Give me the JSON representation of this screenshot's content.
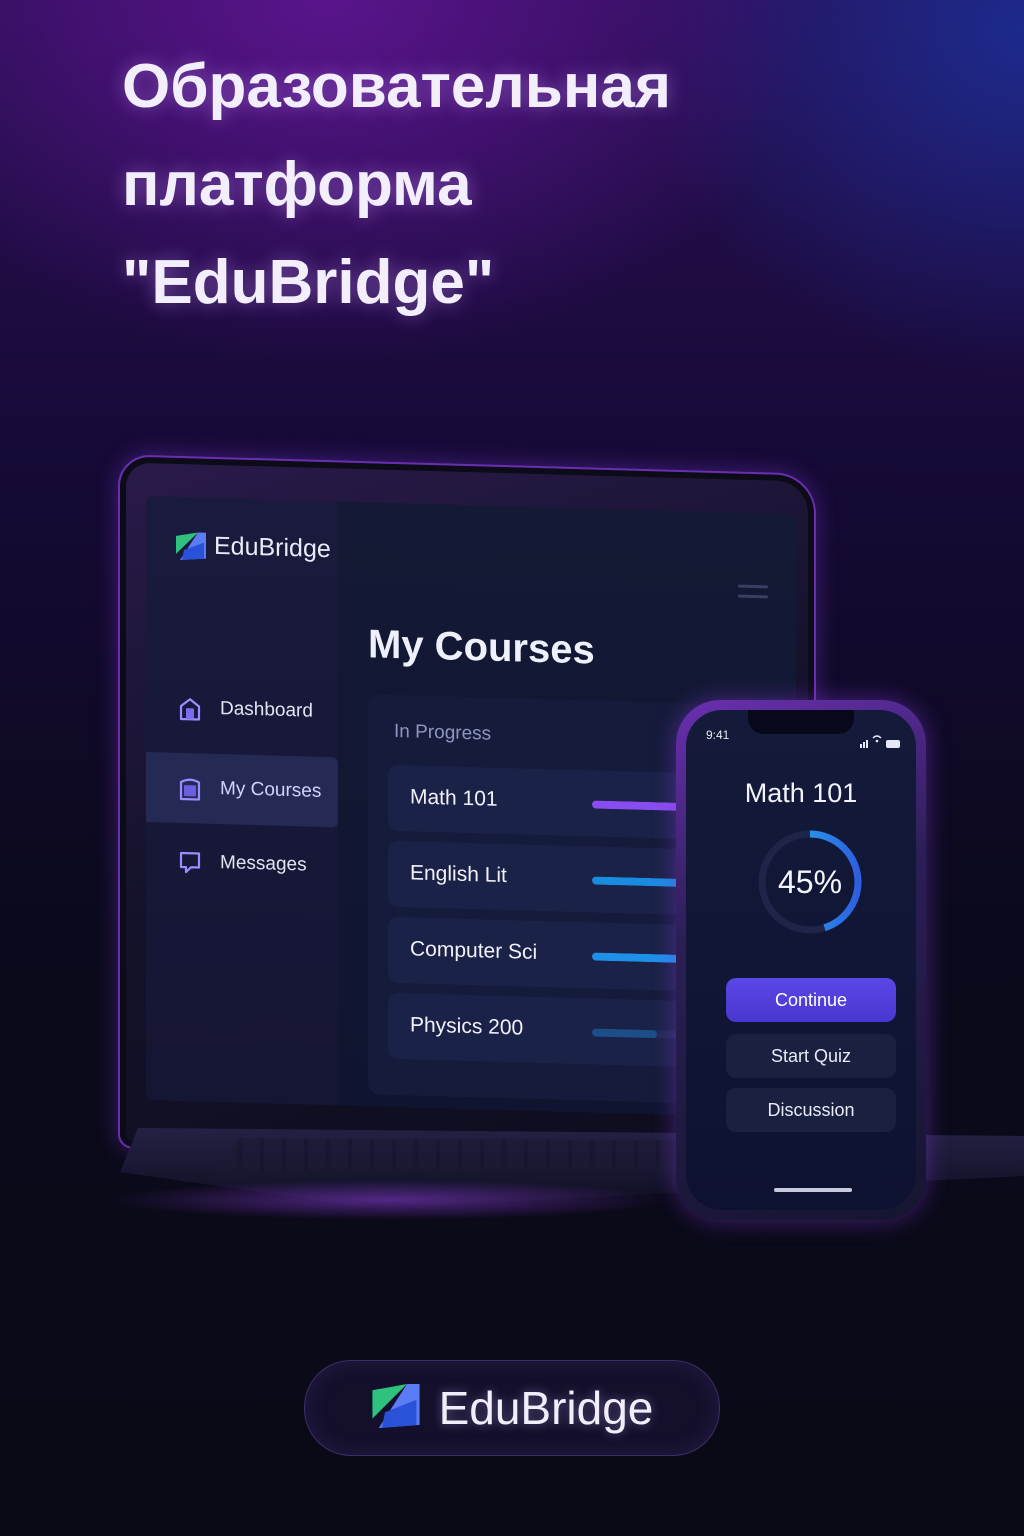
{
  "headline": {
    "line1": "Образовательная",
    "line2": "платформа",
    "line3": "\"EduBridge\""
  },
  "laptop": {
    "brand": "EduBridge",
    "sidebar": {
      "items": [
        {
          "label": "Dashboard",
          "icon": "home-icon",
          "active": false
        },
        {
          "label": "My Courses",
          "icon": "book-icon",
          "active": true
        },
        {
          "label": "Messages",
          "icon": "chat-icon",
          "active": false
        }
      ]
    },
    "main": {
      "title": "My Courses",
      "section_label": "In Progress",
      "courses": [
        {
          "name": "Math 101",
          "progress": 0.9,
          "color": "#8a4cf0"
        },
        {
          "name": "English Lit",
          "progress": 0.6,
          "color": "#1a8ce0"
        },
        {
          "name": "Computer Sci",
          "progress": 0.55,
          "color": "#1e90e8"
        },
        {
          "name": "Physics 200",
          "progress": 0.3,
          "color": "#1d4e8a"
        }
      ]
    }
  },
  "phone": {
    "status_time": "9:41",
    "course_title": "Math 101",
    "progress_value": 45,
    "progress_label": "45%",
    "buttons": {
      "continue": "Continue",
      "start_quiz": "Start Quiz",
      "discussion": "Discussion"
    }
  },
  "footer": {
    "brand": "EduBridge"
  },
  "colors": {
    "accent_purple": "#8a4cf0",
    "accent_blue": "#1aa7e8",
    "button_primary": "#5a47e6"
  }
}
